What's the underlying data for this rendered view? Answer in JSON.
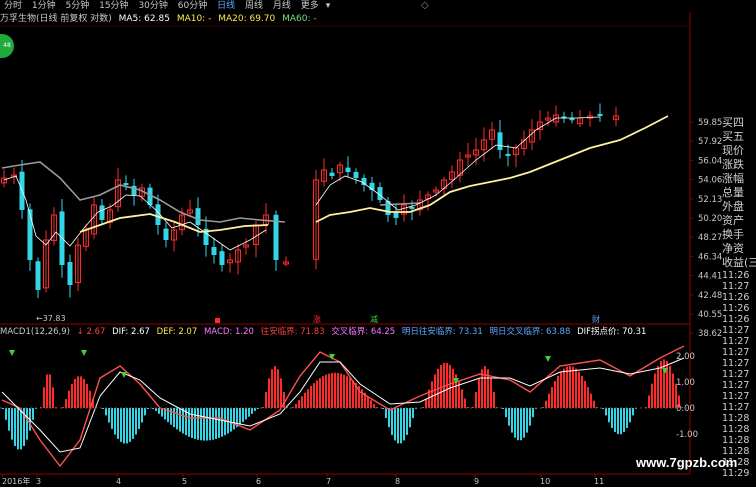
{
  "periods": [
    {
      "label": "分时",
      "active": false
    },
    {
      "label": "1分钟",
      "active": false
    },
    {
      "label": "5分钟",
      "active": false
    },
    {
      "label": "15分钟",
      "active": false
    },
    {
      "label": "30分钟",
      "active": false
    },
    {
      "label": "60分钟",
      "active": false
    },
    {
      "label": "日线",
      "active": true
    },
    {
      "label": "周线",
      "active": false
    },
    {
      "label": "月线",
      "active": false
    },
    {
      "label": "更多",
      "active": false
    }
  ],
  "more_arrow": "▾",
  "chart_header": {
    "title": "万孚生物(日线 前复权 对数)",
    "ma5": "MA5: 62.85",
    "ma10": "MA10: -",
    "ma20": "MA20: 69.70",
    "ma60": "MA60: -"
  },
  "badge": "48",
  "price_axis": [
    "59.85",
    "57.92",
    "56.04",
    "54.06",
    "52.13",
    "50.20",
    "48.27",
    "46.34",
    "44.41",
    "42.48",
    "40.55",
    "38.62"
  ],
  "low_marker": "←37.83",
  "event_marks": [
    {
      "text": "涨",
      "color": "#ff3030"
    },
    {
      "text": "减",
      "color": "#3ad33a"
    },
    {
      "text": "财",
      "color": "#5aa9ff"
    }
  ],
  "macd_header": {
    "name": "MACD1(12,26,9)",
    "value": "↓ 2.67",
    "dif": "DIF: 2.67",
    "dea": "DEF: 2.07",
    "macd": "MACD: 1.20",
    "a": "往安临界: 71.83",
    "b": "交叉临界: 64.25",
    "c": "明日往安临界: 73.31",
    "d": "明日交叉临界: 63.88",
    "e": "DIF拐点价: 70.31"
  },
  "macd_axis": [
    "2.00",
    "1.00",
    "0.00",
    "-1.00"
  ],
  "right_panel": [
    "买四",
    "买五",
    "现价",
    "涨跌",
    "涨幅",
    "总量",
    "外盘",
    "资产",
    "换手",
    "净资",
    "收益(三)",
    "11:26",
    "11:27",
    "11:26",
    "11:26",
    "11:26",
    "11:27",
    "11:27",
    "11:27",
    "11:27",
    "11:27",
    "11:27",
    "11:27",
    "11:27",
    "11:28",
    "11:28",
    "11:28",
    "11:28",
    "11:28",
    "11:29"
  ],
  "date_axis": [
    "2016年",
    "3",
    "4",
    "5",
    "6",
    "7",
    "8",
    "9",
    "10",
    "11"
  ],
  "watermark": "www.7gpzb.com",
  "colors": {
    "up": "#ff2a2a",
    "down": "#33d6e6",
    "ma_yellow": "#fff0a0",
    "ma_gray": "#9a9a9a",
    "dif": "#ffffff",
    "dea": "#ff5050"
  }
}
